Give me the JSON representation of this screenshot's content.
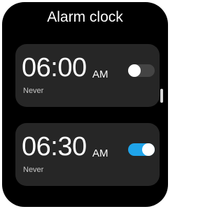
{
  "app": {
    "title": "Alarm clock"
  },
  "alarms": [
    {
      "time": "06:00",
      "period": "AM",
      "repeat": "Never",
      "enabled": false
    },
    {
      "time": "06:30",
      "period": "AM",
      "repeat": "Never",
      "enabled": true
    }
  ],
  "colors": {
    "background": "#000000",
    "card": "#262626",
    "toggle_on": "#1fa4ea",
    "toggle_off": "#444444"
  }
}
